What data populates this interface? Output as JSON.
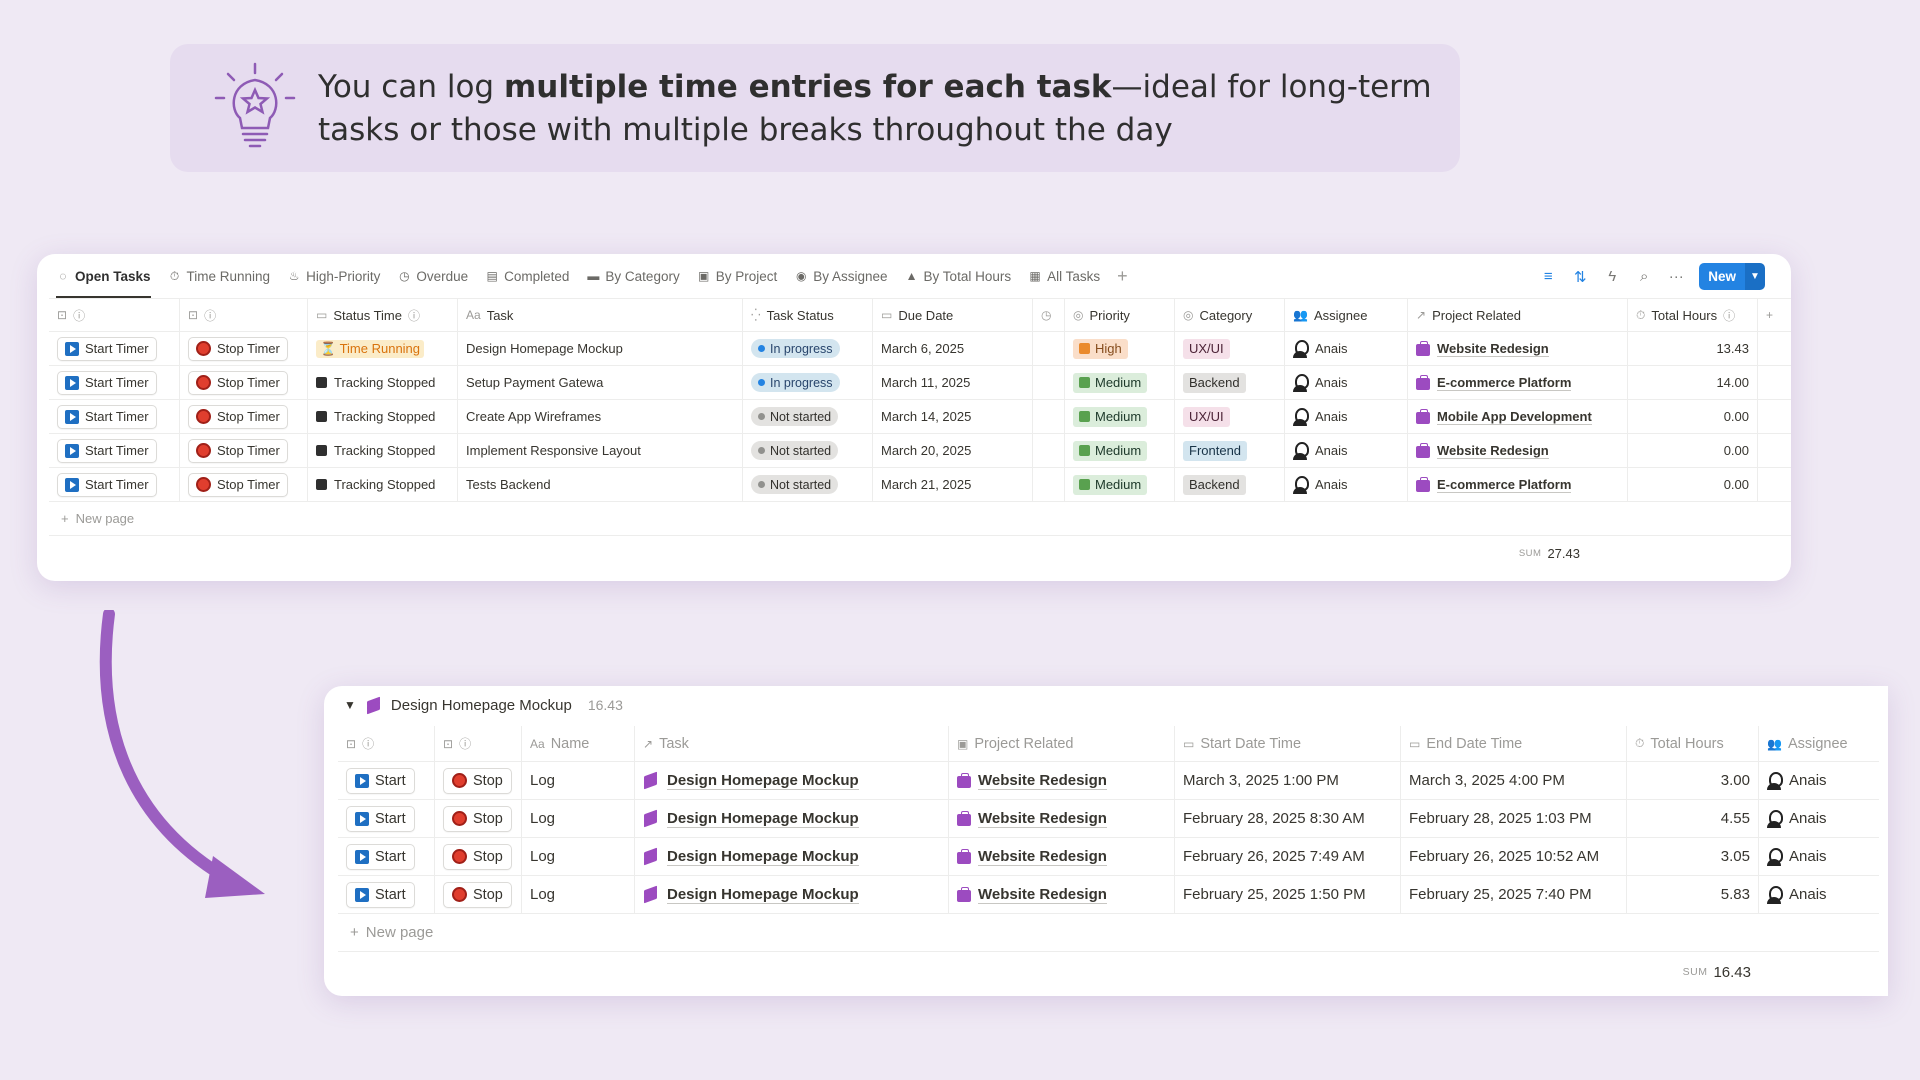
{
  "tip": {
    "text_pre": "You can log ",
    "text_bold": "multiple time entries for each task",
    "text_post": "—ideal for long-term tasks or those with multiple breaks throughout the day",
    "icon": "lightbulb-icon"
  },
  "tasks_view": {
    "tabs": [
      {
        "label": "Open Tasks",
        "icon": "loading-circle-icon",
        "active": true
      },
      {
        "label": "Time Running",
        "icon": "stopwatch-icon"
      },
      {
        "label": "High-Priority",
        "icon": "fire-icon"
      },
      {
        "label": "Overdue",
        "icon": "clock-alert-icon"
      },
      {
        "label": "Completed",
        "icon": "archive-icon"
      },
      {
        "label": "By Category",
        "icon": "folder-icon"
      },
      {
        "label": "By Project",
        "icon": "briefcase-icon"
      },
      {
        "label": "By Assignee",
        "icon": "user-circle-icon"
      },
      {
        "label": "By Total Hours",
        "icon": "mountain-icon"
      },
      {
        "label": "All Tasks",
        "icon": "table-icon"
      }
    ],
    "new_label": "New",
    "columns": {
      "status_time": "Status Time",
      "task": "Task",
      "task_status": "Task Status",
      "due_date": "Due Date",
      "priority": "Priority",
      "category": "Category",
      "assignee": "Assignee",
      "project": "Project Related",
      "total_hours": "Total Hours",
      "task_prefix": "Aa"
    },
    "start_label": "Start Timer",
    "stop_label": "Stop Timer",
    "rows": [
      {
        "status_time": "Time Running",
        "running": true,
        "task": "Design Homepage Mockup",
        "task_status": "In progress",
        "due": "March 6, 2025",
        "priority": "High",
        "category": "UX/UI",
        "assignee": "Anais",
        "project": "Website Redesign",
        "hours": "13.43"
      },
      {
        "status_time": "Tracking Stopped",
        "running": false,
        "task": "Setup Payment Gatewa",
        "task_status": "In progress",
        "due": "March 11, 2025",
        "priority": "Medium",
        "category": "Backend",
        "assignee": "Anais",
        "project": "E-commerce Platform",
        "hours": "14.00"
      },
      {
        "status_time": "Tracking Stopped",
        "running": false,
        "task": "Create App Wireframes",
        "task_status": "Not started",
        "due": "March 14, 2025",
        "priority": "Medium",
        "category": "UX/UI",
        "assignee": "Anais",
        "project": "Mobile App Development",
        "hours": "0.00"
      },
      {
        "status_time": "Tracking Stopped",
        "running": false,
        "task": "Implement Responsive Layout",
        "task_status": "Not started",
        "due": "March 20, 2025",
        "priority": "Medium",
        "category": "Frontend",
        "assignee": "Anais",
        "project": "Website Redesign",
        "hours": "0.00"
      },
      {
        "status_time": "Tracking Stopped",
        "running": false,
        "task": "Tests Backend",
        "task_status": "Not started",
        "due": "March 21, 2025",
        "priority": "Medium",
        "category": "Backend",
        "assignee": "Anais",
        "project": "E-commerce Platform",
        "hours": "0.00"
      }
    ],
    "new_page": "New page",
    "sum_label": "SUM",
    "sum_value": "27.43"
  },
  "log_view": {
    "group_title": "Design Homepage Mockup",
    "group_count": "16.43",
    "columns": {
      "name": "Name",
      "name_prefix": "Aa",
      "task": "Task",
      "project": "Project Related",
      "start": "Start Date Time",
      "end": "End Date Time",
      "total_hours": "Total Hours",
      "assignee": "Assignee"
    },
    "start_label": "Start",
    "stop_label": "Stop",
    "rows": [
      {
        "name": "Log",
        "task": "Design Homepage Mockup",
        "project": "Website Redesign",
        "start": "March 3, 2025 1:00 PM",
        "end": "March 3, 2025 4:00 PM",
        "hours": "3.00",
        "assignee": "Anais"
      },
      {
        "name": "Log",
        "task": "Design Homepage Mockup",
        "project": "Website Redesign",
        "start": "February 28, 2025 8:30 AM",
        "end": "February 28, 2025 1:03 PM",
        "hours": "4.55",
        "assignee": "Anais"
      },
      {
        "name": "Log",
        "task": "Design Homepage Mockup",
        "project": "Website Redesign",
        "start": "February 26, 2025 7:49 AM",
        "end": "February 26, 2025 10:52 AM",
        "hours": "3.05",
        "assignee": "Anais"
      },
      {
        "name": "Log",
        "task": "Design Homepage Mockup",
        "project": "Website Redesign",
        "start": "February 25, 2025 1:50 PM",
        "end": "February 25, 2025 7:40 PM",
        "hours": "5.83",
        "assignee": "Anais"
      }
    ],
    "new_page": "New page",
    "sum_label": "SUM",
    "sum_value": "16.43"
  }
}
